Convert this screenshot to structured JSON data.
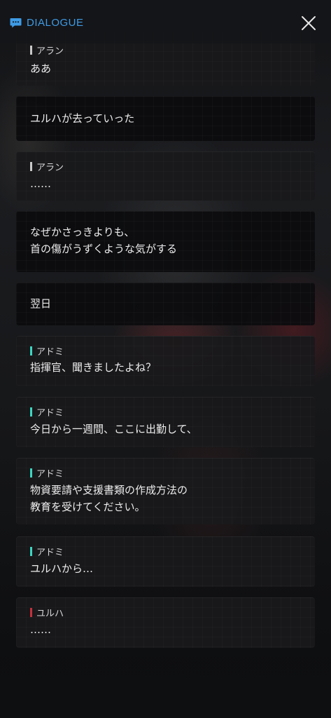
{
  "header": {
    "title": "DIALOGUE",
    "icon": "chat-bubble-icon",
    "close_icon": "close-icon"
  },
  "colors": {
    "accent": "#3e9be6",
    "speaker_alan": "#c9c9c9",
    "speaker_admi": "#3dd6c0",
    "speaker_yulha": "#c4303b"
  },
  "entries": [
    {
      "speaker": "アラン",
      "text": "ああ"
    },
    {
      "speaker": "",
      "text": "ユルハが去っていった"
    },
    {
      "speaker": "アラン",
      "text": "……"
    },
    {
      "speaker": "",
      "text": "なぜかさっきよりも、\n首の傷がうずくような気がする"
    },
    {
      "speaker": "",
      "text": "翌日"
    },
    {
      "speaker": "アドミ",
      "text": "指揮官、聞きましたよね？"
    },
    {
      "speaker": "アドミ",
      "text": "今日から一週間、ここに出勤して、"
    },
    {
      "speaker": "アドミ",
      "text": "物資要請や支援書類の作成方法の\n教育を受けてください。"
    },
    {
      "speaker": "アドミ",
      "text": "ユルハから…"
    },
    {
      "speaker": "ユルハ",
      "text": "……"
    }
  ]
}
